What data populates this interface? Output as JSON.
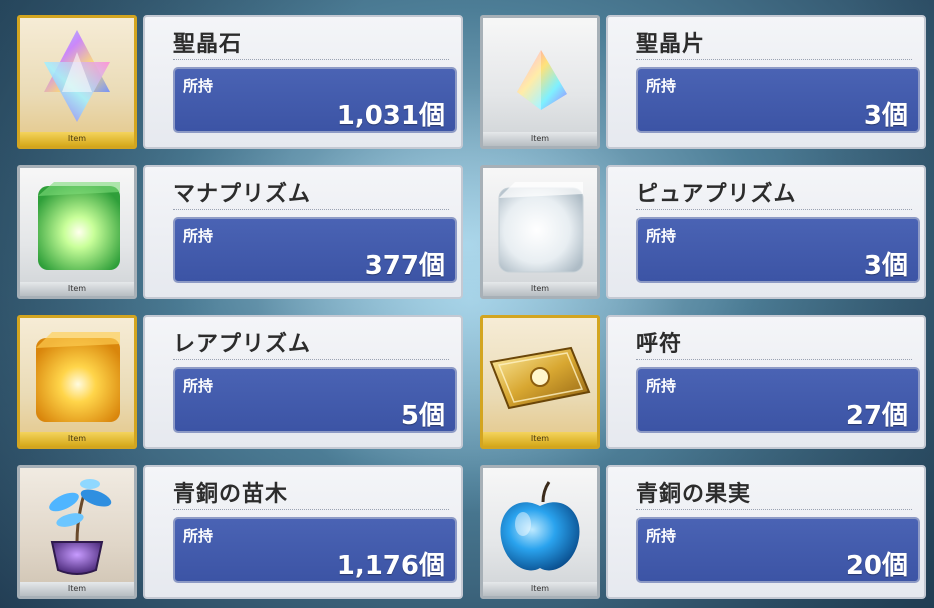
{
  "owned_label": "所持",
  "item_tag": "Item",
  "items": [
    {
      "name": "聖晶石",
      "count": "1,031個",
      "frame": "gold",
      "icon": "saint-quartz-icon"
    },
    {
      "name": "聖晶片",
      "count": "3個",
      "frame": "silver",
      "icon": "saint-quartz-fragment-icon"
    },
    {
      "name": "マナプリズム",
      "count": "377個",
      "frame": "silver",
      "icon": "mana-prism-icon"
    },
    {
      "name": "ピュアプリズム",
      "count": "3個",
      "frame": "silver",
      "icon": "pure-prism-icon"
    },
    {
      "name": "レアプリズム",
      "count": "5個",
      "frame": "gold",
      "icon": "rare-prism-icon"
    },
    {
      "name": "呼符",
      "count": "27個",
      "frame": "gold",
      "icon": "summon-ticket-icon"
    },
    {
      "name": "青銅の苗木",
      "count": "1,176個",
      "frame": "wood",
      "icon": "bronze-sapling-icon"
    },
    {
      "name": "青銅の果実",
      "count": "20個",
      "frame": "silver",
      "icon": "bronze-fruit-icon"
    }
  ],
  "colors": {
    "gold_frame": "#d3a520",
    "silver_frame": "#a7b0b7",
    "qty_panel": "#3c54a5"
  }
}
